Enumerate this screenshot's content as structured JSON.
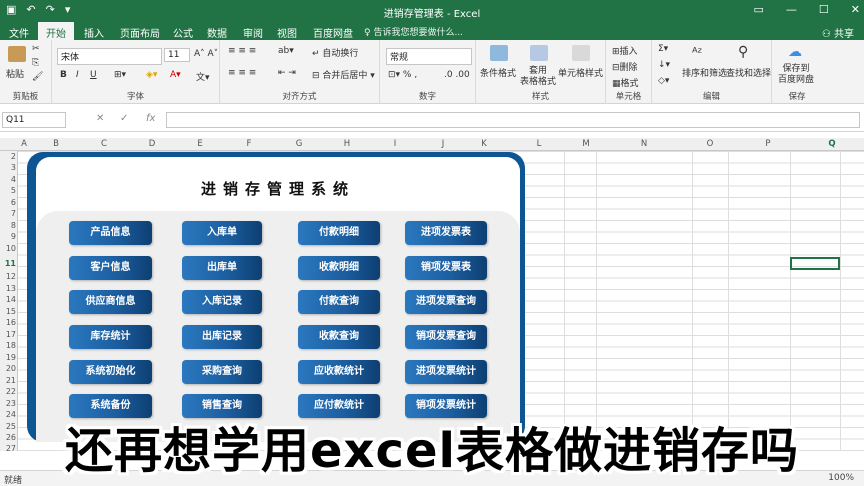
{
  "titlebar": {
    "document_title": "进销存管理表 - Excel",
    "qa_icons": [
      "save-icon",
      "undo-icon",
      "redo-icon",
      "customize-icon"
    ]
  },
  "tabs": [
    "文件",
    "开始",
    "插入",
    "页面布局",
    "公式",
    "数据",
    "审阅",
    "视图",
    "百度网盘"
  ],
  "active_tab": "开始",
  "tell_me": "告诉我您想要做什么...",
  "share": "共享",
  "ribbon": {
    "paste": "粘贴",
    "clipboard": "剪贴板",
    "font_name": "宋体",
    "font_size": "11",
    "font_group": "字体",
    "wrap_text": "自动换行",
    "merge_center": "合并后居中",
    "align_group": "对齐方式",
    "number_format": "常规",
    "number_group": "数字",
    "conditional_format": "条件格式",
    "table_format": "套用\n表格格式",
    "cell_styles": "单元格样式",
    "styles_group": "样式",
    "insert": "插入",
    "delete": "删除",
    "format": "格式",
    "cells_group": "单元格",
    "sort_filter": "排序和筛选",
    "find_select": "查找和选择",
    "edit_group": "编辑",
    "save_baidu": "保存到\n百度网盘",
    "save_group": "保存",
    "bold": "B",
    "italic": "I",
    "underline": "U"
  },
  "formula_bar": {
    "name_box": "Q11",
    "fx": "fx",
    "cancel": "✕",
    "enter": "✓",
    "content": ""
  },
  "columns": [
    "A",
    "B",
    "C",
    "D",
    "E",
    "F",
    "G",
    "H",
    "I",
    "J",
    "K",
    "L",
    "M",
    "N",
    "O",
    "P",
    "Q"
  ],
  "rows": [
    "2",
    "3",
    "4",
    "5",
    "6",
    "7",
    "8",
    "9",
    "10",
    "11",
    "12",
    "13",
    "14",
    "15",
    "16",
    "17",
    "18",
    "19",
    "20",
    "21",
    "22",
    "23",
    "24",
    "25",
    "26",
    "27"
  ],
  "system": {
    "title": "进销存管理系统",
    "buttons": [
      [
        "产品信息",
        "入库单",
        "付款明细",
        "进项发票表"
      ],
      [
        "客户信息",
        "出库单",
        "收款明细",
        "销项发票表"
      ],
      [
        "供应商信息",
        "入库记录",
        "付款查询",
        "进项发票查询"
      ],
      [
        "库存统计",
        "出库记录",
        "收款查询",
        "销项发票查询"
      ],
      [
        "系统初始化",
        "采购查询",
        "应收款统计",
        "进项发票统计"
      ],
      [
        "系统备份",
        "销售查询",
        "应付款统计",
        "销项发票统计"
      ]
    ]
  },
  "status": {
    "ready": "就绪",
    "zoom": "100%"
  },
  "subtitle": "还再想学用excel表格做进销存吗"
}
